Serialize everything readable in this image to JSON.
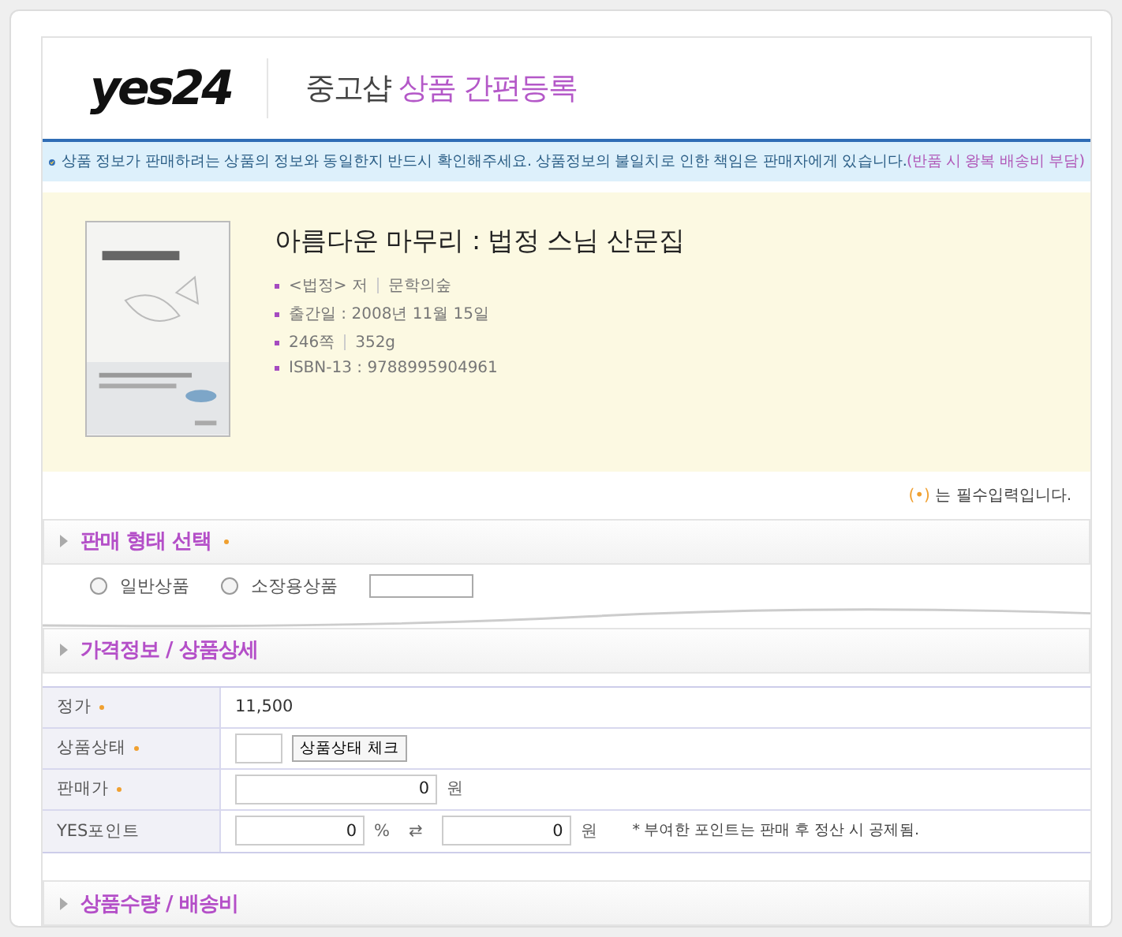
{
  "header": {
    "logo": "yes24",
    "title_prefix": "중고샵",
    "title_main": "상품 간편등록"
  },
  "notice": {
    "text": "상품 정보가 판매하려는 상품의 정보와 동일한지 반드시 확인해주세요. 상품정보의 불일치로 인한 책임은 판매자에게 있습니다.",
    "note": "(반품 시 왕복 배송비 부담)"
  },
  "book": {
    "title": "아름다운 마무리 : 법정 스님 산문집",
    "meta": [
      [
        "<법정> 저",
        "문학의숲"
      ],
      [
        "출간일 : 2008년 11월 15일"
      ],
      [
        "246쪽",
        "352g"
      ],
      [
        "ISBN-13 : 9788995904961"
      ]
    ]
  },
  "required_note": {
    "mark": "(•)",
    "text": "는 필수입력입니다."
  },
  "sale_type": {
    "title": "판매 형태 선택",
    "required": true,
    "options": [
      {
        "label": "일반상품",
        "selected": false
      },
      {
        "label": "소장용상품",
        "selected": false
      }
    ]
  },
  "price_section": {
    "title": "가격정보 / 상품상세"
  },
  "rows": [
    {
      "kind": "text",
      "label": "정가",
      "required": true,
      "value": "11,500"
    },
    {
      "kind": "condition",
      "label": "상품상태",
      "required": true,
      "button": "상품상태 체크"
    },
    {
      "kind": "price",
      "label": "판매가",
      "required": true,
      "value": "0",
      "unit": "원"
    },
    {
      "kind": "points",
      "label": "YES포인트",
      "percent": "0",
      "percent_unit": "%",
      "swap": "⇄",
      "value": "0",
      "unit": "원",
      "hint": "* 부여한 포인트는 판매 후 정산 시 공제됨."
    }
  ],
  "qty_section": {
    "title": "상품수량 / 배송비"
  }
}
